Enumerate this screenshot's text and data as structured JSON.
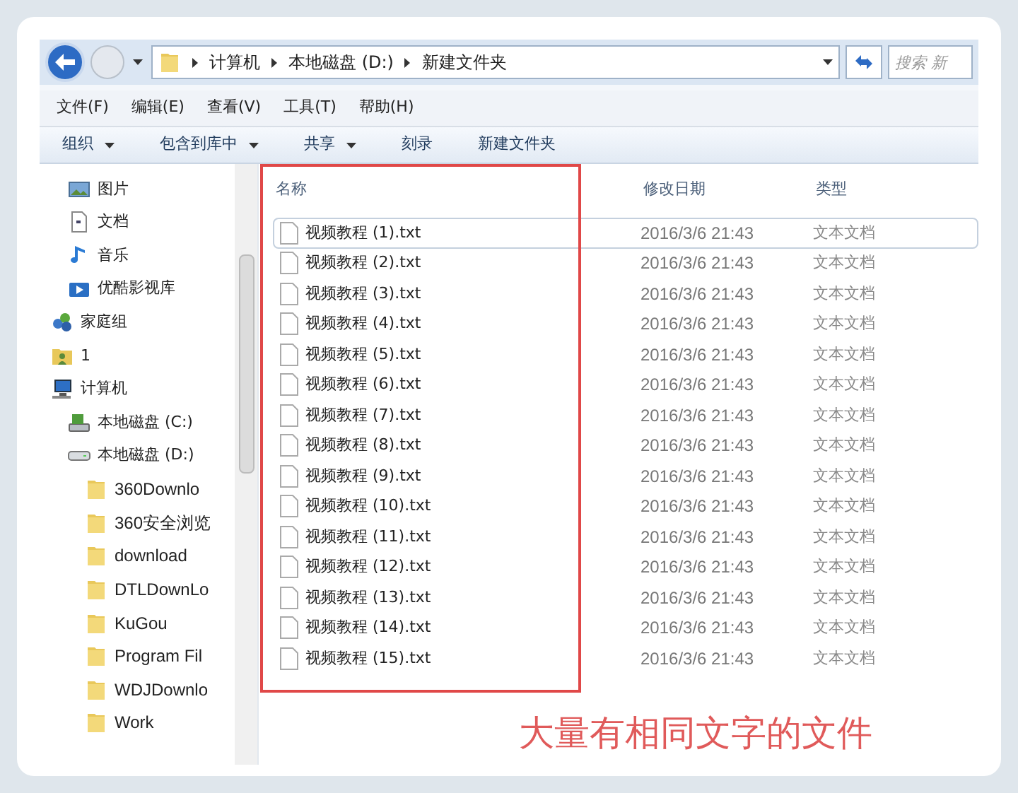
{
  "address_bar": {
    "breadcrumbs": [
      "计算机",
      "本地磁盘 (D:)",
      "新建文件夹"
    ],
    "search": {
      "placeholder": "搜索 新"
    }
  },
  "menu_bar": [
    "文件(F)",
    "编辑(E)",
    "查看(V)",
    "工具(T)",
    "帮助(H)"
  ],
  "toolbar": [
    {
      "label": "组织",
      "dropdown": true
    },
    {
      "label": "包含到库中",
      "dropdown": true
    },
    {
      "label": "共享",
      "dropdown": true
    },
    {
      "label": "刻录",
      "dropdown": false
    },
    {
      "label": "新建文件夹",
      "dropdown": false
    }
  ],
  "sidebar": {
    "library_items": [
      {
        "label": "图片",
        "kind": "pictures"
      },
      {
        "label": "文档",
        "kind": "document"
      },
      {
        "label": "音乐",
        "kind": "music"
      },
      {
        "label": "优酷影视库",
        "kind": "video"
      }
    ],
    "items": [
      {
        "label": "家庭组",
        "kind": "homegroup"
      },
      {
        "label": "1",
        "kind": "user"
      },
      {
        "label": "计算机",
        "kind": "computer",
        "children": [
          {
            "label": "本地磁盘 (C:)",
            "kind": "system-drive"
          },
          {
            "label": "本地磁盘 (D:)",
            "kind": "drive",
            "children": [
              {
                "label": "360Downlo",
                "kind": "folder"
              },
              {
                "label": "360安全浏览",
                "kind": "folder"
              },
              {
                "label": "download",
                "kind": "folder"
              },
              {
                "label": "DTLDownLo",
                "kind": "folder"
              },
              {
                "label": "KuGou",
                "kind": "folder"
              },
              {
                "label": "Program Fil",
                "kind": "folder"
              },
              {
                "label": "WDJDownlo",
                "kind": "folder"
              },
              {
                "label": "Work",
                "kind": "folder"
              }
            ]
          }
        ]
      }
    ]
  },
  "table": {
    "columns": [
      "名称",
      "修改日期",
      "类型"
    ],
    "rows": [
      {
        "name": "视频教程 (1).txt",
        "date": "2016/3/6 21:43",
        "type": "文本文档",
        "selected": true
      },
      {
        "name": "视频教程 (2).txt",
        "date": "2016/3/6 21:43",
        "type": "文本文档",
        "selected": false
      },
      {
        "name": "视频教程 (3).txt",
        "date": "2016/3/6 21:43",
        "type": "文本文档",
        "selected": false
      },
      {
        "name": "视频教程 (4).txt",
        "date": "2016/3/6 21:43",
        "type": "文本文档",
        "selected": false
      },
      {
        "name": "视频教程 (5).txt",
        "date": "2016/3/6 21:43",
        "type": "文本文档",
        "selected": false
      },
      {
        "name": "视频教程 (6).txt",
        "date": "2016/3/6 21:43",
        "type": "文本文档",
        "selected": false
      },
      {
        "name": "视频教程 (7).txt",
        "date": "2016/3/6 21:43",
        "type": "文本文档",
        "selected": false
      },
      {
        "name": "视频教程 (8).txt",
        "date": "2016/3/6 21:43",
        "type": "文本文档",
        "selected": false
      },
      {
        "name": "视频教程 (9).txt",
        "date": "2016/3/6 21:43",
        "type": "文本文档",
        "selected": false
      },
      {
        "name": "视频教程 (10).txt",
        "date": "2016/3/6 21:43",
        "type": "文本文档",
        "selected": false
      },
      {
        "name": "视频教程 (11).txt",
        "date": "2016/3/6 21:43",
        "type": "文本文档",
        "selected": false
      },
      {
        "name": "视频教程 (12).txt",
        "date": "2016/3/6 21:43",
        "type": "文本文档",
        "selected": false
      },
      {
        "name": "视频教程 (13).txt",
        "date": "2016/3/6 21:43",
        "type": "文本文档",
        "selected": false
      },
      {
        "name": "视频教程 (14).txt",
        "date": "2016/3/6 21:43",
        "type": "文本文档",
        "selected": false
      },
      {
        "name": "视频教程 (15).txt",
        "date": "2016/3/6 21:43",
        "type": "文本文档",
        "selected": false
      }
    ]
  },
  "annotation": {
    "caption": "大量有相同文字的文件"
  }
}
